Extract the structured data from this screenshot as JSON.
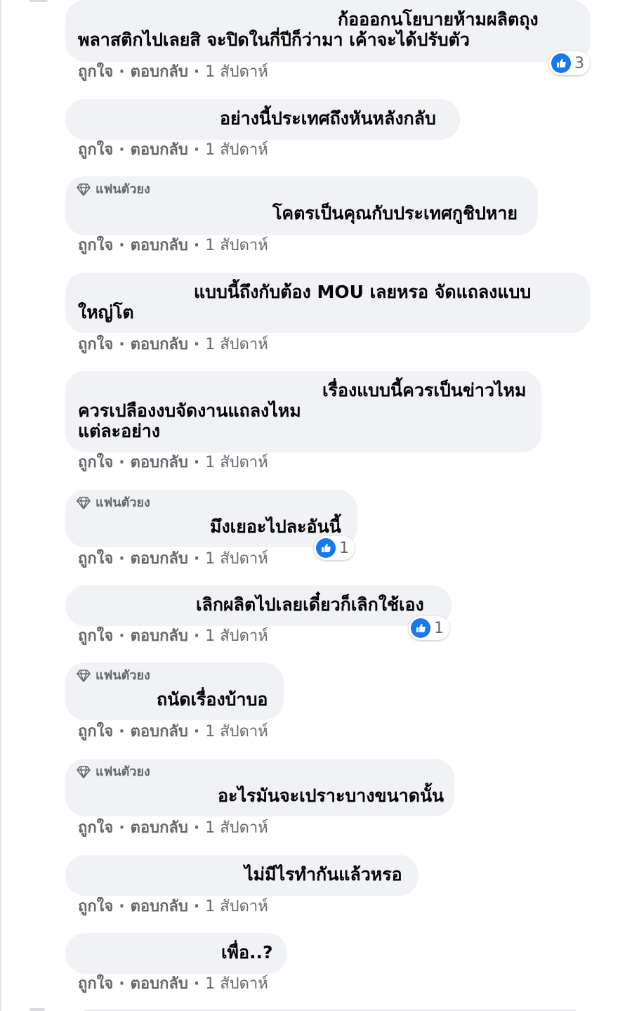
{
  "labels": {
    "like": "ถูกใจ",
    "reply": "ตอบกลับ",
    "separator": "·",
    "time": "1 สัปดาห์",
    "badge": "แฟนตัวยง"
  },
  "comments": [
    {
      "lines": [
        "ก้อออกนโยบายห้ามผลิตถุง",
        "พลาสติกไปเลยสิ จะปิดในกี่ปีก็ว่ามา เค้าจะได้ปรับตัว"
      ],
      "reactions": "3"
    },
    {
      "lines": [
        "อย่างนี้ประเทศถึงหันหลังกลับ"
      ]
    },
    {
      "lines": [
        "โคตรเป็นคุณกับประเทศกูชิปหาย"
      ],
      "badge": true
    },
    {
      "lines": [
        "แบบนี้ถึงกับต้อง MOU เลยหรอ จัดแถลงแบบ",
        "ใหญ่โต"
      ]
    },
    {
      "lines": [
        "เรื่องแบบนี้ควรเป็นข่าวไหม",
        "ควรเปลืองงบจัดงานแถลงไหม",
        "แต่ละอย่าง"
      ]
    },
    {
      "lines": [
        "มึงเยอะไปละอันนี้"
      ],
      "badge": true,
      "reactions": "1"
    },
    {
      "lines": [
        "เลิกผลิตไปเลยเดี๋ยวก็เลิกใช้เอง"
      ],
      "reactions": "1"
    },
    {
      "lines": [
        "ถนัดเรื่องบ้าบอ"
      ],
      "badge": true
    },
    {
      "lines": [
        "อะไรมันจะเปราะบางขนาดนั้น"
      ],
      "badge": true
    },
    {
      "lines": [
        "ไม่มีไรทำกันแล้วหรอ"
      ]
    },
    {
      "lines": [
        "เพื่อ..?"
      ]
    }
  ]
}
